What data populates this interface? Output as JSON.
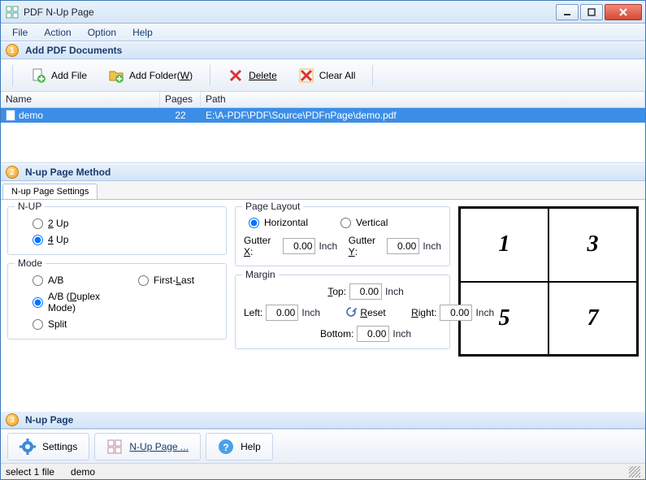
{
  "window": {
    "title": "PDF N-Up Page"
  },
  "menu": {
    "file": "File",
    "action": "Action",
    "option": "Option",
    "help": "Help"
  },
  "section1": {
    "num": "1",
    "title": "Add PDF Documents"
  },
  "toolbar": {
    "add_file": "Add File",
    "add_folder_pre": "Add Folder(",
    "add_folder_key": "W",
    "add_folder_post": ")",
    "delete": "Delete",
    "clear_all": "Clear All"
  },
  "columns": {
    "name": "Name",
    "pages": "Pages",
    "path": "Path"
  },
  "rows": [
    {
      "name": "demo",
      "pages": "22",
      "path": "E:\\A-PDF\\PDF\\Source\\PDFnPage\\demo.pdf"
    }
  ],
  "section2": {
    "num": "2",
    "title": "N-up Page  Method"
  },
  "tab": {
    "settings": "N-up Page Settings"
  },
  "nup": {
    "legend": "N-UP",
    "opt2_key": "2",
    "opt2_post": " Up",
    "opt4_key": "4",
    "opt4_post": " Up"
  },
  "mode": {
    "legend": "Mode",
    "ab": "A/B",
    "ab_duplex_pre": "A/B (",
    "ab_duplex_key": "D",
    "ab_duplex_post": "uplex Mode)",
    "split": "Split",
    "firstlast_pre": "First-",
    "firstlast_key": "L",
    "firstlast_post": "ast"
  },
  "layout": {
    "legend": "Page Layout",
    "horizontal": "Horizontal",
    "vertical": "Vertical",
    "gutter_x_pre": "Gutter ",
    "gutter_x_key": "X",
    "gutter_x_post": ":",
    "gutter_y_pre": "Gutter ",
    "gutter_y_key": "Y",
    "gutter_y_post": ":",
    "gx": "0.00",
    "gy": "0.00",
    "unit": "Inch"
  },
  "margin": {
    "legend": "Margin",
    "top_key": "T",
    "top_post": "op:",
    "left": "Left:",
    "right_key": "R",
    "right_post": "ight:",
    "bottom": "Bottom:",
    "reset_key": "R",
    "reset_post": "eset",
    "t": "0.00",
    "l": "0.00",
    "r": "0.00",
    "b": "0.00",
    "unit": "Inch"
  },
  "preview": {
    "a": "1",
    "b": "3",
    "c": "5",
    "d": "7"
  },
  "section3": {
    "num": "3",
    "title": "N-up Page"
  },
  "bottom": {
    "settings": "Settings",
    "nup": "N-Up Page ...",
    "help": "Help"
  },
  "status": {
    "sel": "select 1 file",
    "name": "demo"
  }
}
